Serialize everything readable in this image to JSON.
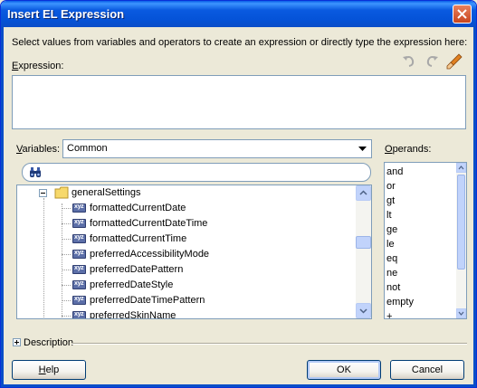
{
  "window": {
    "title": "Insert EL Expression"
  },
  "instructions": "Select values from variables and operators to create an expression or directly type the expression here:",
  "expression": {
    "label_mnemonic": "E",
    "label_rest": "xpression:",
    "value": ""
  },
  "toolbar": {
    "icons": [
      "undo-icon",
      "redo-icon",
      "clear-icon"
    ]
  },
  "variables": {
    "label_mnemonic": "V",
    "label_rest": "ariables:",
    "selected": "Common",
    "search_value": "",
    "tree": {
      "folder": "generalSettings",
      "items": [
        "formattedCurrentDate",
        "formattedCurrentDateTime",
        "formattedCurrentTime",
        "preferredAccessibilityMode",
        "preferredDatePattern",
        "preferredDateStyle",
        "preferredDateTimePattern",
        "preferredSkinName"
      ]
    }
  },
  "operands": {
    "label_mnemonic": "O",
    "label_rest": "perands:",
    "items": [
      "and",
      "or",
      "gt",
      "lt",
      "ge",
      "le",
      "eq",
      "ne",
      "not",
      "empty",
      "+"
    ]
  },
  "description": {
    "label": "Description"
  },
  "buttons": {
    "help_mnemonic": "H",
    "help_rest": "elp",
    "ok": "OK",
    "cancel": "Cancel"
  },
  "colors": {
    "titlebar": "#0a5ae0",
    "dialog_bg": "#ece9d8",
    "field_border": "#7f9db9"
  }
}
